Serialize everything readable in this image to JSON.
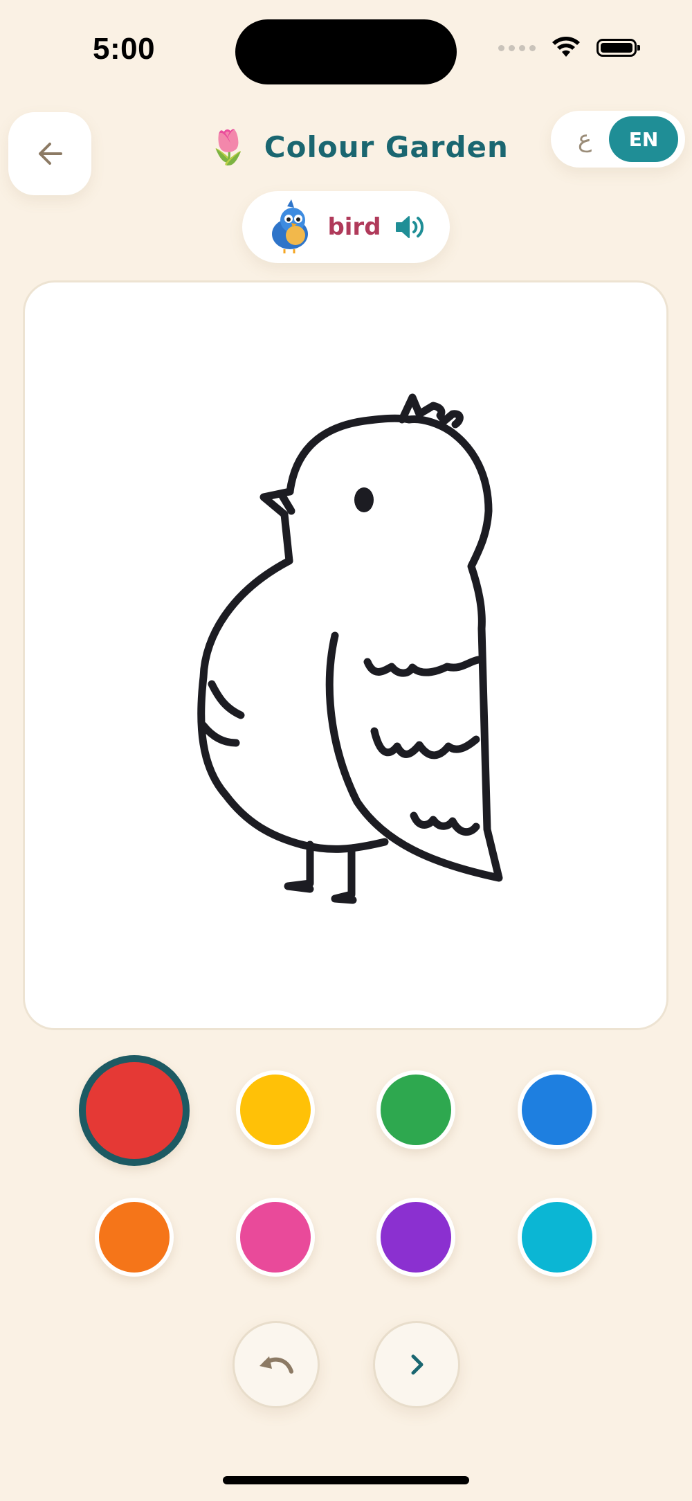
{
  "status_bar": {
    "time": "5:00",
    "icons": [
      "cellular-signal-icon",
      "wifi-icon",
      "battery-icon"
    ]
  },
  "header": {
    "back_icon": "arrow-left-icon",
    "title_emoji": "🌷",
    "title": "Colour Garden",
    "language_toggle": {
      "alternate_label": "ع",
      "active_label": "EN"
    }
  },
  "word": {
    "emoji": "🐦",
    "label": "bird",
    "speaker_icon": "speaker-icon"
  },
  "canvas": {
    "drawing": "bird-outline"
  },
  "palette": {
    "colors": [
      "#E53935",
      "#FFC107",
      "#2EA84F",
      "#1E7FE0",
      "#F57519",
      "#E94A9A",
      "#8B30D0",
      "#0BB6D4"
    ],
    "selected_index": 0
  },
  "controls": {
    "undo_icon": "undo-icon",
    "next_icon": "chevron-right-icon"
  }
}
